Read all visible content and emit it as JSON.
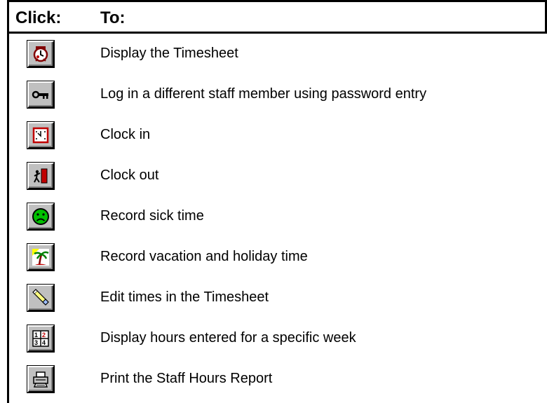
{
  "header": {
    "click_label": "Click:",
    "to_label": "To:"
  },
  "rows": [
    {
      "icon": "timesheet-clock-icon",
      "description": "Display the Timesheet"
    },
    {
      "icon": "key-icon",
      "description": "Log in a different staff member using password entry"
    },
    {
      "icon": "clock-in-icon",
      "description": "Clock in"
    },
    {
      "icon": "exit-door-icon",
      "description": "Clock out"
    },
    {
      "icon": "sad-face-icon",
      "description": "Record sick time"
    },
    {
      "icon": "palm-tree-icon",
      "description": "Record vacation and holiday time"
    },
    {
      "icon": "eraser-pencil-icon",
      "description": "Edit times in the Timesheet"
    },
    {
      "icon": "calendar-week-icon",
      "description": "Display hours entered for a specific week"
    },
    {
      "icon": "printer-icon",
      "description": "Print the Staff Hours Report"
    }
  ]
}
